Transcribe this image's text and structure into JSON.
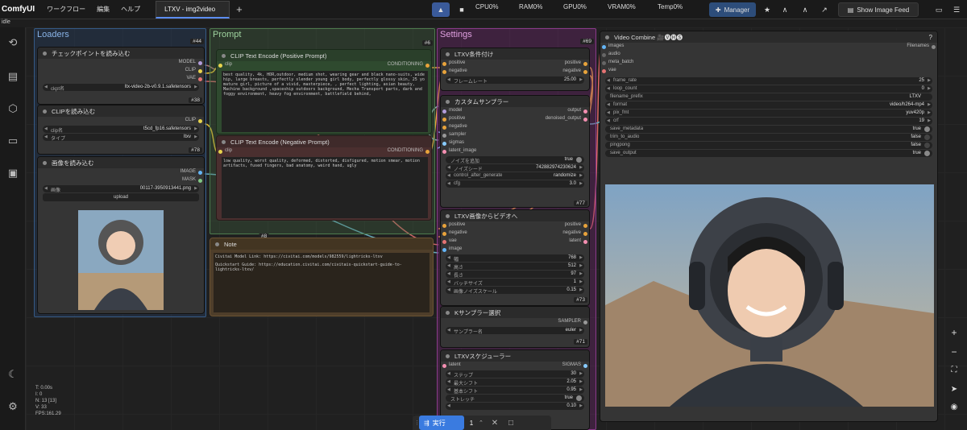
{
  "app": {
    "brand": "ComfyUI",
    "menus": [
      "ワークフロー",
      "編集",
      "ヘルプ"
    ],
    "tab": "LTXV - img2video",
    "status": "idle"
  },
  "stats": {
    "cpu": "CPU0%",
    "ram": "RAM0%",
    "gpu": "GPU0%",
    "vram": "VRAM0%",
    "temp": "Temp0%"
  },
  "toolbar": {
    "manager": "Manager",
    "feed": "Show Image Feed"
  },
  "groups": {
    "loaders": "Loaders",
    "prompt": "Prompt",
    "settings": "Settings"
  },
  "ckpt": {
    "title": "チェックポイントを読み込む",
    "badge": "#38",
    "out1": "MODEL",
    "out2": "CLIP",
    "out3": "VAE",
    "w_label": "ckpt名",
    "w_value": "ltx-video-2b-v0.9.1.safetensors"
  },
  "clipload": {
    "title": "CLIPを読み込む",
    "badge": "#78",
    "out": "CLIP",
    "w1_label": "clip名",
    "w1_value": "t5cd_fp16.safetensors",
    "w2_label": "タイプ",
    "w2_value": "ltxv"
  },
  "imgload": {
    "title": "画像を読み込む",
    "out1": "IMAGE",
    "out2": "MASK",
    "w_label": "画像",
    "w_value": "00117-3950913441.png",
    "upload": "upload"
  },
  "loaders_badge": "#44",
  "pos": {
    "title": "CLIP Text Encode (Positive Prompt)",
    "in": "clip",
    "out": "CONDITIONING",
    "text": "best quality, 4k, HDR,outdoor, medium shot, wearing gear and black nano-suits, wide hip, large breasts, perfectly slender young girl body, perfectly glossy skin, 25 yo mature girl, picture of a vivid, masterpiece, , perfect lighting, asian beauty, Machine background ,spaceship outdoors background, Mecha Transport parts, dark and foggy environment, heavy fog environment, battlefield behind,"
  },
  "neg": {
    "title": "CLIP Text Encode (Negative Prompt)",
    "in": "clip",
    "out": "CONDITIONING",
    "text": "low quality, worst quality, deformed, distorted, disfigured, motion smear, motion artifacts, fused fingers, bad anatomy, weird hand, ugly"
  },
  "prompt_badges": {
    "a": "#6",
    "b": "#8"
  },
  "note": {
    "title": "Note",
    "line1": "Civitai Model Link: https://civitai.com/models/982559/lightricks-ltxv",
    "line2": "Quickstart Guide: https://education.civitai.com/civitais-quickstart-guide-to-lightricks-ltxv/"
  },
  "settings_badge": "#69",
  "ltxvcond": {
    "title": "LTXV条件付け",
    "in1": "positive",
    "in2": "negative",
    "out1": "positive",
    "out2": "negative",
    "w_label": "フレームレート",
    "w_value": "25.00"
  },
  "sampler": {
    "title": "カスタムサンプラー",
    "badge": "#77",
    "ins": [
      "model",
      "positive",
      "negative",
      "sampler",
      "sigmas",
      "latent_image"
    ],
    "out1": "output",
    "out2": "denoised_output",
    "widgets": [
      {
        "l": "ノイズを追加",
        "v": "true"
      },
      {
        "l": "ノイズシード",
        "v": "742882974230624"
      },
      {
        "l": "control_after_generate",
        "v": "randomize"
      },
      {
        "l": "cfg",
        "v": "3.0"
      }
    ]
  },
  "img2vid": {
    "title": "LTXV画像からビデオへ",
    "badge": "#73",
    "ins": [
      "positive",
      "negative",
      "vae",
      "image"
    ],
    "outs": [
      "positive",
      "negative",
      "latent"
    ],
    "widgets": [
      {
        "l": "幅",
        "v": "768"
      },
      {
        "l": "高さ",
        "v": "512"
      },
      {
        "l": "長さ",
        "v": "97"
      },
      {
        "l": "バッチサイズ",
        "v": "1"
      },
      {
        "l": "画像ノイズスケール",
        "v": "0.15"
      }
    ]
  },
  "ksel": {
    "title": "Kサンプラー選択",
    "badge": "#71",
    "out": "SAMPLER",
    "w_label": "サンプラー名",
    "w_value": "euler"
  },
  "sched": {
    "title": "LTXVスケジューラー",
    "in": "latent",
    "out": "SIGMAS",
    "widgets": [
      {
        "l": "ステップ",
        "v": "30"
      },
      {
        "l": "最大シフト",
        "v": "2.05"
      },
      {
        "l": "基本シフト",
        "v": "0.95"
      },
      {
        "l": "ストレッチ",
        "v": "true"
      },
      {
        "l": "",
        "v": "0.10"
      }
    ]
  },
  "vc": {
    "title": "Video Combine 🎥🅥🅗🅢",
    "help": "?",
    "ins": [
      "images",
      "audio",
      "meta_batch",
      "vae"
    ],
    "out": "Filenames",
    "widgets": [
      {
        "l": "frame_rate",
        "v": "25"
      },
      {
        "l": "loop_count",
        "v": "0"
      },
      {
        "l": "filename_prefix",
        "v": "LTXV"
      },
      {
        "l": "format",
        "v": "video/h264-mp4"
      },
      {
        "l": "pix_fmt",
        "v": "yuv420p"
      },
      {
        "l": "crf",
        "v": "19"
      }
    ],
    "toggles": [
      {
        "l": "save_metadata",
        "v": "true"
      },
      {
        "l": "trim_to_audio",
        "v": "false"
      },
      {
        "l": "pingpong",
        "v": "false"
      },
      {
        "l": "save_output",
        "v": "true"
      }
    ]
  },
  "info": {
    "t": "T: 0.00s",
    "i": "I: 0",
    "n": "N: 13 [13]",
    "v": "V: 33",
    "fps": "FPS:161.29"
  },
  "run": {
    "label": "実行",
    "count": "1"
  },
  "colors": {
    "accent": "#5c8df0",
    "loaders": "#2f4f6f",
    "prompt": "#3e5a3e",
    "settings": "#6a2a6a"
  }
}
